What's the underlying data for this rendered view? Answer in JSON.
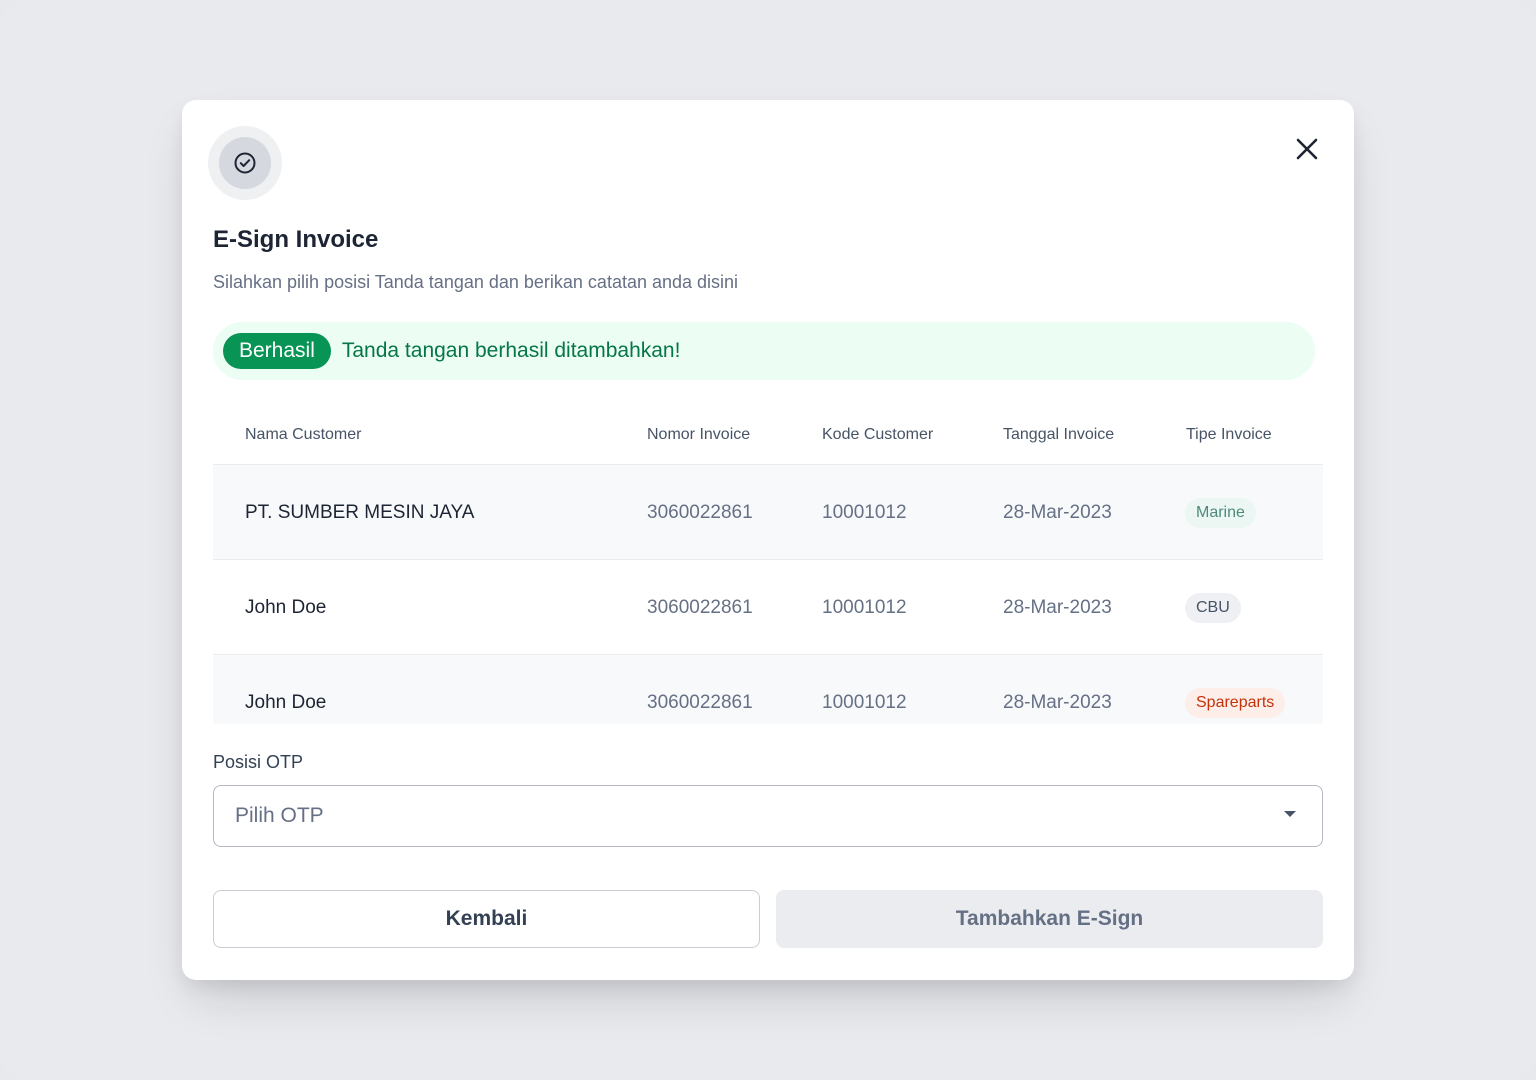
{
  "modal": {
    "title": "E-Sign Invoice",
    "subtitle": "Silahkan pilih posisi Tanda tangan dan berikan catatan anda disini"
  },
  "alert": {
    "badge": "Berhasil",
    "message": "Tanda tangan berhasil ditambahkan!"
  },
  "table": {
    "headers": [
      "Nama Customer",
      "Nomor Invoice",
      "Kode Customer",
      "Tanggal Invoice",
      "Tipe Invoice"
    ],
    "rows": [
      {
        "name": "PT. SUMBER MESIN JAYA",
        "invoice": "3060022861",
        "code": "10001012",
        "date": "28-Mar-2023",
        "type": "Marine"
      },
      {
        "name": "John Doe",
        "invoice": "3060022861",
        "code": "10001012",
        "date": "28-Mar-2023",
        "type": "CBU"
      },
      {
        "name": "John Doe",
        "invoice": "3060022861",
        "code": "10001012",
        "date": "28-Mar-2023",
        "type": "Spareparts"
      }
    ]
  },
  "badge_colors": {
    "Marine": {
      "bg": "#ecf6f3",
      "fg": "#4e8a7c"
    },
    "CBU": {
      "bg": "#eef0f3",
      "fg": "#475467"
    },
    "Spareparts": {
      "bg": "#fdeeea",
      "fg": "#c4320a"
    }
  },
  "form": {
    "otp_label": "Posisi OTP",
    "otp_placeholder": "Pilih OTP"
  },
  "buttons": {
    "back": "Kembali",
    "add": "Tambahkan E-Sign"
  },
  "icons": {
    "header": "check-circle-icon",
    "close": "close-icon",
    "select": "caret-down-icon"
  }
}
